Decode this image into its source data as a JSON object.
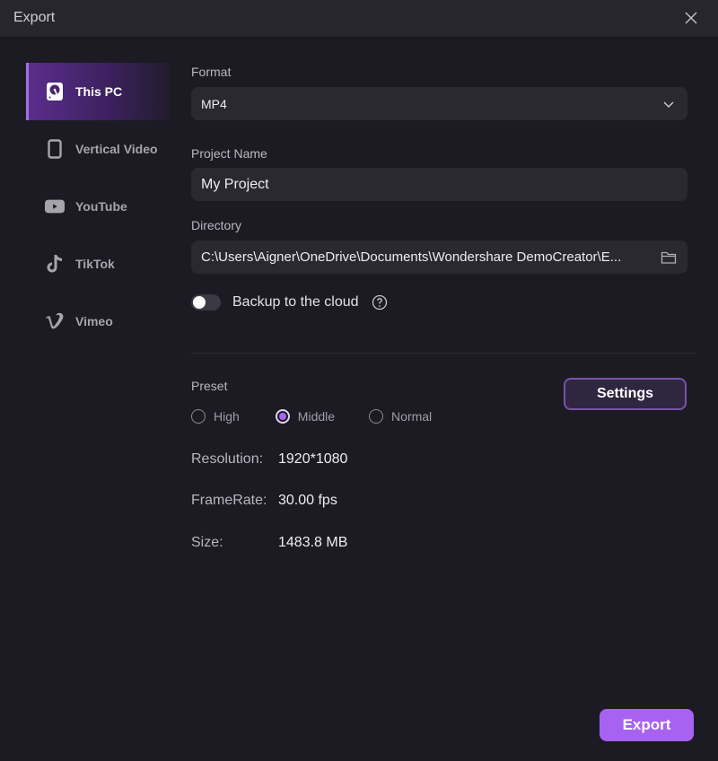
{
  "window": {
    "title": "Export",
    "close_icon": "close-icon"
  },
  "sidebar": {
    "items": [
      {
        "label": "This PC",
        "icon": "hard-drive-icon",
        "active": true
      },
      {
        "label": "Vertical Video",
        "icon": "phone-icon",
        "active": false
      },
      {
        "label": "YouTube",
        "icon": "youtube-icon",
        "active": false
      },
      {
        "label": "TikTok",
        "icon": "tiktok-icon",
        "active": false
      },
      {
        "label": "Vimeo",
        "icon": "vimeo-icon",
        "active": false
      }
    ]
  },
  "form": {
    "format": {
      "label": "Format",
      "value": "MP4",
      "icon": "chevron-down-icon"
    },
    "project_name": {
      "label": "Project Name",
      "value": "My Project"
    },
    "directory": {
      "label": "Directory",
      "value": "C:\\Users\\Aigner\\OneDrive\\Documents\\Wondershare DemoCreator\\E...",
      "icon": "folder-icon"
    },
    "backup": {
      "label": "Backup to the cloud",
      "enabled": false,
      "icon": "help-circle-icon"
    }
  },
  "preset": {
    "label": "Preset",
    "options": [
      {
        "label": "High",
        "checked": false
      },
      {
        "label": "Middle",
        "checked": true
      },
      {
        "label": "Normal",
        "checked": false
      }
    ],
    "settings_label": "Settings"
  },
  "info": [
    {
      "key": "Resolution:",
      "value": "1920*1080"
    },
    {
      "key": "FrameRate:",
      "value": "30.00 fps"
    },
    {
      "key": "Size:",
      "value": "1483.8 MB"
    }
  ],
  "footer": {
    "export_label": "Export"
  },
  "colors": {
    "accent": "#a762f2",
    "background": "#1c1b24",
    "titlebar": "#27262f",
    "field": "#2a2932"
  }
}
